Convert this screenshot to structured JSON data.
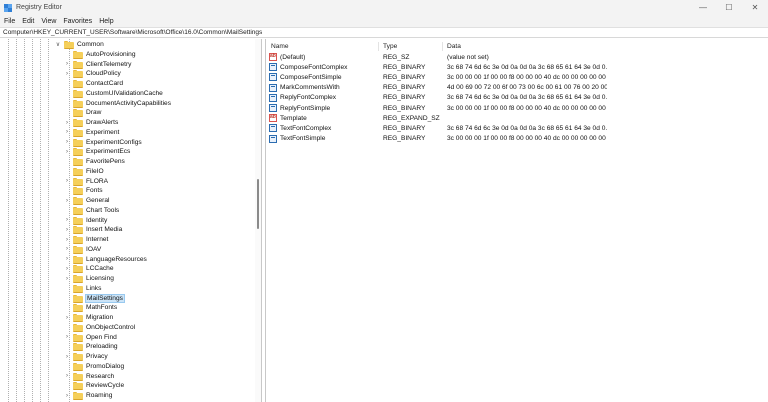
{
  "window": {
    "title": "Registry Editor",
    "minimize_glyph": "—",
    "maximize_glyph": "☐",
    "close_glyph": "✕"
  },
  "menu": [
    {
      "label": "File"
    },
    {
      "label": "Edit"
    },
    {
      "label": "View"
    },
    {
      "label": "Favorites"
    },
    {
      "label": "Help"
    }
  ],
  "address": "Computer\\HKEY_CURRENT_USER\\Software\\Microsoft\\Office\\16.0\\Common\\MailSettings",
  "tree": {
    "parent": {
      "label": "Common",
      "chevron": "∨"
    },
    "items": [
      {
        "label": "AutoProvisioning",
        "expandable": false
      },
      {
        "label": "ClientTelemetry",
        "expandable": true
      },
      {
        "label": "CloudPolicy",
        "expandable": true
      },
      {
        "label": "ContactCard",
        "expandable": false
      },
      {
        "label": "CustomUIValidationCache",
        "expandable": false
      },
      {
        "label": "DocumentActivityCapabilities",
        "expandable": false
      },
      {
        "label": "Draw",
        "expandable": false
      },
      {
        "label": "DrawAlerts",
        "expandable": true
      },
      {
        "label": "Experiment",
        "expandable": true
      },
      {
        "label": "ExperimentConfigs",
        "expandable": true
      },
      {
        "label": "ExperimentEcs",
        "expandable": true
      },
      {
        "label": "FavoritePens",
        "expandable": false
      },
      {
        "label": "FileIO",
        "expandable": false
      },
      {
        "label": "FLORA",
        "expandable": true
      },
      {
        "label": "Fonts",
        "expandable": false
      },
      {
        "label": "General",
        "expandable": true
      },
      {
        "label": "Chart Tools",
        "expandable": false
      },
      {
        "label": "Identity",
        "expandable": true
      },
      {
        "label": "Insert Media",
        "expandable": true
      },
      {
        "label": "Internet",
        "expandable": true
      },
      {
        "label": "IOAV",
        "expandable": true
      },
      {
        "label": "LanguageResources",
        "expandable": true
      },
      {
        "label": "LCCache",
        "expandable": true
      },
      {
        "label": "Licensing",
        "expandable": true
      },
      {
        "label": "Links",
        "expandable": false
      },
      {
        "label": "MailSettings",
        "expandable": false,
        "selected": true
      },
      {
        "label": "MathFonts",
        "expandable": false
      },
      {
        "label": "Migration",
        "expandable": true
      },
      {
        "label": "OnObjectControl",
        "expandable": false
      },
      {
        "label": "Open Find",
        "expandable": true
      },
      {
        "label": "Preloading",
        "expandable": false
      },
      {
        "label": "Privacy",
        "expandable": true
      },
      {
        "label": "PromoDialog",
        "expandable": false
      },
      {
        "label": "Research",
        "expandable": true
      },
      {
        "label": "ReviewCycle",
        "expandable": false
      },
      {
        "label": "Roaming",
        "expandable": true
      }
    ]
  },
  "list": {
    "headers": {
      "name": "Name",
      "type": "Type",
      "data": "Data"
    },
    "rows": [
      {
        "name": "(Default)",
        "type": "REG_SZ",
        "data": "(value not set)",
        "icon": "string-value-icon"
      },
      {
        "name": "ComposeFontComplex",
        "type": "REG_BINARY",
        "data": "3c 68 74 6d 6c 3e 0d 0a 0d 0a 3c 68 65 61 64 3e 0d 0...",
        "icon": "binary-value-icon"
      },
      {
        "name": "ComposeFontSimple",
        "type": "REG_BINARY",
        "data": "3c 00 00 00 1f 00 00 f8 00 00 00 40 dc 00 00 00 00 00 ...",
        "icon": "binary-value-icon"
      },
      {
        "name": "MarkCommentsWith",
        "type": "REG_BINARY",
        "data": "4d 00 69 00 72 00 6f 00 73 00 6c 00 61 00 76 00 20 00 ...",
        "icon": "binary-value-icon"
      },
      {
        "name": "ReplyFontComplex",
        "type": "REG_BINARY",
        "data": "3c 68 74 6d 6c 3e 0d 0a 0d 0a 3c 68 65 61 64 3e 0d 0...",
        "icon": "binary-value-icon"
      },
      {
        "name": "ReplyFontSimple",
        "type": "REG_BINARY",
        "data": "3c 00 00 00 1f 00 00 f8 00 00 00 40 dc 00 00 00 00 00 ...",
        "icon": "binary-value-icon"
      },
      {
        "name": "Template",
        "type": "REG_EXPAND_SZ",
        "data": "",
        "icon": "string-value-icon"
      },
      {
        "name": "TextFontComplex",
        "type": "REG_BINARY",
        "data": "3c 68 74 6d 6c 3e 0d 0a 0d 0a 3c 68 65 61 64 3e 0d 0...",
        "icon": "binary-value-icon"
      },
      {
        "name": "TextFontSimple",
        "type": "REG_BINARY",
        "data": "3c 00 00 00 1f 00 00 f8 00 00 00 40 dc 00 00 00 00 00 ...",
        "icon": "binary-value-icon"
      }
    ]
  }
}
